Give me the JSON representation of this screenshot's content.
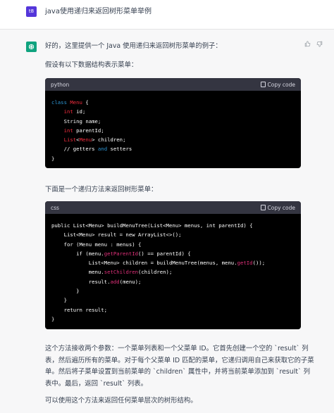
{
  "user": {
    "avatar_initials": "t8",
    "message": "java使用递归来返回树形菜单举例"
  },
  "assistant": {
    "intro": "好的，这里提供一个 Java 使用递归来返回树形菜单的例子：",
    "data_struct_intro": "假设有以下数据结构表示菜单：",
    "code_block_1": {
      "language": "python",
      "copy_label": "Copy code",
      "lines": [
        "class Menu {",
        "    int id;",
        "    String name;",
        "    int parentId;",
        "    List<Menu> children;",
        "    // getters and setters",
        "}"
      ]
    },
    "method_intro": "下面是一个递归方法来返回树形菜单：",
    "code_block_2": {
      "language": "css",
      "copy_label": "Copy code",
      "lines": [
        "public List<Menu> buildMenuTree(List<Menu> menus, int parentId) {",
        "    List<Menu> result = new ArrayList<>();",
        "    for (Menu menu : menus) {",
        "        if (menu.getParentId() == parentId) {",
        "            List<Menu> children = buildMenuTree(menus, menu.getId());",
        "            menu.setChildren(children);",
        "            result.add(menu);",
        "        }",
        "    }",
        "    return result;",
        "}"
      ]
    },
    "explanation_lines": [
      "这个方法接收两个参数：一个菜单列表和一个父菜单 ID。它首先创建一个空的 `result` 列",
      "表，然后遍历所有的菜单。对于每个父菜单 ID 匹配的菜单，它递归调用自己来获取它的子菜",
      "单。然后将子菜单设置到当前菜单的 `children` 属性中，并将当前菜单添加到 `result` 列",
      "表中。最后，返回 `result` 列表。"
    ],
    "closing": "可以使用这个方法来返回任何菜单层次的树形结构。"
  },
  "icons": {
    "thumb_up": "thumb-up-icon",
    "thumb_down": "thumb-down-icon",
    "copy": "clipboard-icon",
    "assistant_logo": "openai-logo-icon"
  },
  "colors": {
    "user_avatar": "#5436da",
    "assistant_avatar": "#10a37f",
    "code_bg": "#000000",
    "code_header_bg": "#343541"
  }
}
